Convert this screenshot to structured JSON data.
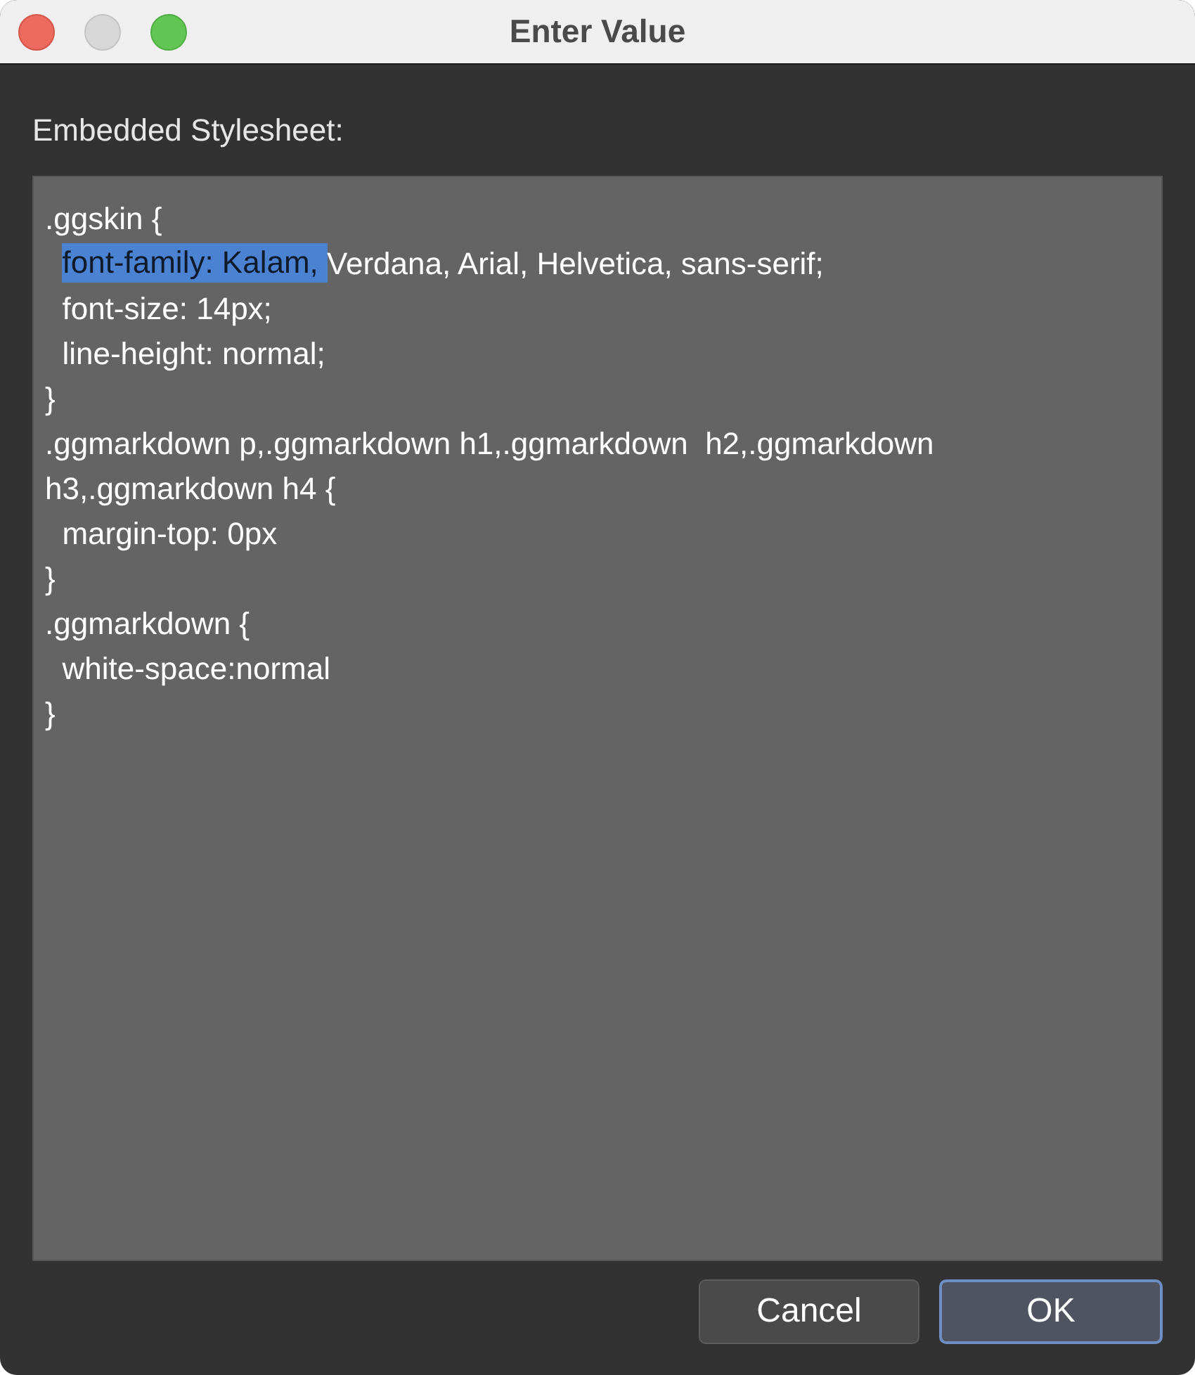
{
  "window": {
    "title": "Enter Value"
  },
  "field_label": "Embedded Stylesheet:",
  "editor": {
    "lines": [
      [
        {
          "text": ".ggskin {",
          "selected": false
        }
      ],
      [
        {
          "text": "  font-family: Kalam, ",
          "selected": true
        },
        {
          "text": "Verdana, Arial, Helvetica, sans-serif;",
          "selected": false
        }
      ],
      [
        {
          "text": "  font-size: 14px;",
          "selected": false
        }
      ],
      [
        {
          "text": "  line-height: normal;",
          "selected": false
        }
      ],
      [
        {
          "text": "}",
          "selected": false
        }
      ],
      [
        {
          "text": ".ggmarkdown p,.ggmarkdown h1,.ggmarkdown  h2,.ggmarkdown",
          "selected": false
        }
      ],
      [
        {
          "text": "h3,.ggmarkdown h4 {",
          "selected": false
        }
      ],
      [
        {
          "text": "  margin-top: 0px",
          "selected": false
        }
      ],
      [
        {
          "text": "}",
          "selected": false
        }
      ],
      [
        {
          "text": ".ggmarkdown {",
          "selected": false
        }
      ],
      [
        {
          "text": "  white-space:normal",
          "selected": false
        }
      ],
      [
        {
          "text": "}",
          "selected": false
        }
      ]
    ]
  },
  "buttons": [
    {
      "label": "Cancel",
      "default": false
    },
    {
      "label": "OK",
      "default": true
    }
  ]
}
